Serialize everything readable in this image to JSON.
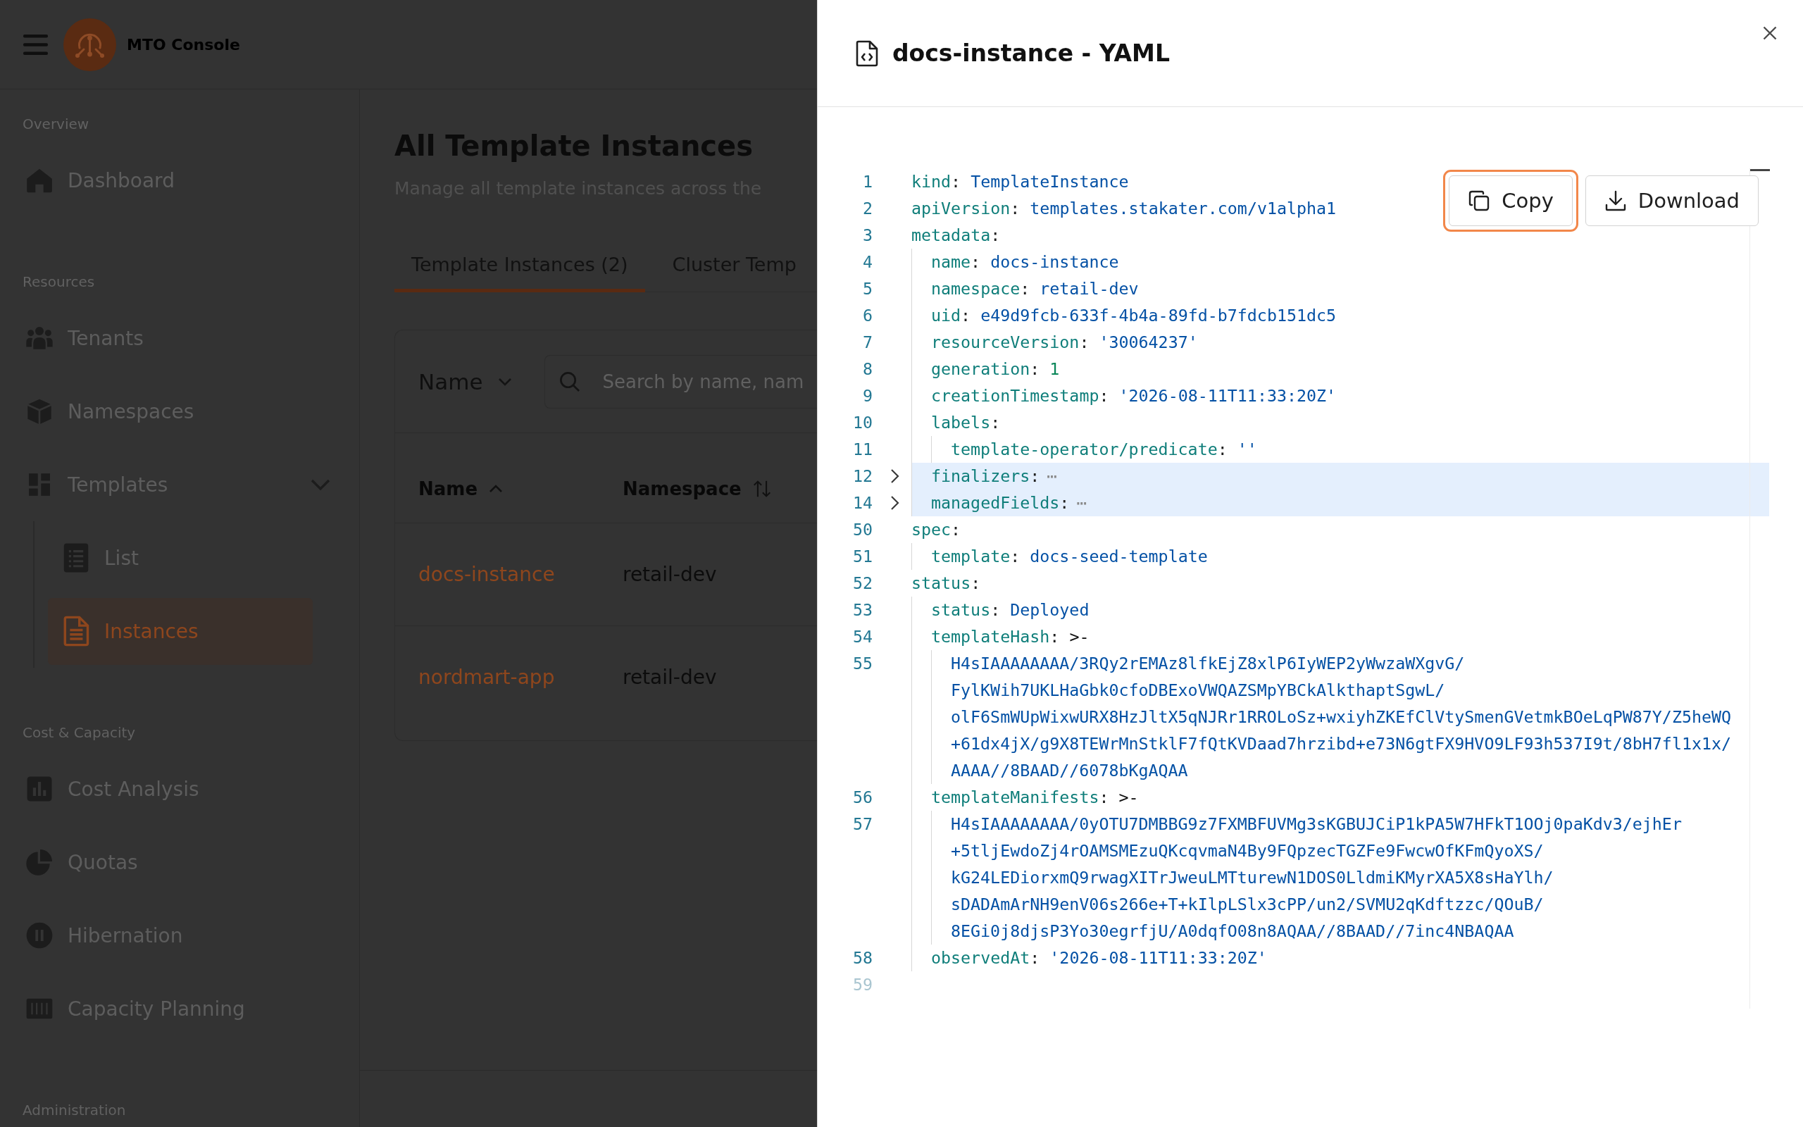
{
  "header": {
    "brand": "MTO Console"
  },
  "sidebar": {
    "sections": [
      {
        "label": "Overview",
        "items": [
          {
            "label": "Dashboard",
            "selected": false
          }
        ]
      },
      {
        "label": "Resources",
        "items": [
          {
            "label": "Tenants",
            "selected": false
          },
          {
            "label": "Namespaces",
            "selected": false
          },
          {
            "label": "Templates",
            "selected": false,
            "expanded": true,
            "children": [
              {
                "label": "List",
                "selected": false
              },
              {
                "label": "Instances",
                "selected": true
              }
            ]
          }
        ]
      },
      {
        "label": "Cost & Capacity",
        "items": [
          {
            "label": "Cost Analysis",
            "selected": false
          },
          {
            "label": "Quotas",
            "selected": false
          },
          {
            "label": "Hibernation",
            "selected": false
          },
          {
            "label": "Capacity Planning",
            "selected": false
          }
        ]
      },
      {
        "label": "Administration"
      }
    ]
  },
  "page": {
    "title": "All Template Instances",
    "subtitle": "Manage all template instances across the",
    "tabs": [
      {
        "label": "Template Instances (2)",
        "selected": true
      },
      {
        "label": "Cluster Temp",
        "selected": false
      }
    ],
    "filter": {
      "field": "Name",
      "search": {
        "placeholder": "Search by name, nam"
      }
    },
    "table": {
      "columns": [
        {
          "label": "Name",
          "sorted": true,
          "kind": "link"
        },
        {
          "label": "Namespace",
          "sorted": false,
          "kind": "text"
        }
      ],
      "rows": [
        {
          "cells": [
            "docs-instance",
            "retail-dev"
          ]
        },
        {
          "cells": [
            "nordmart-app",
            "retail-dev"
          ]
        }
      ]
    }
  },
  "drawer": {
    "title": "docs-instance - YAML",
    "actions": [
      {
        "label": "Copy",
        "focused": true
      },
      {
        "label": "Download",
        "focused": false
      }
    ],
    "editor": {
      "lines": [
        {
          "number": "1",
          "folded": false,
          "dimmed": false,
          "tokens": [
            {
              "text": "kind",
              "kind": "key"
            },
            {
              "text": ": ",
              "kind": "punct"
            },
            {
              "text": "TemplateInstance",
              "kind": "string"
            }
          ]
        },
        {
          "number": "2",
          "folded": false,
          "dimmed": false,
          "tokens": [
            {
              "text": "apiVersion",
              "kind": "key"
            },
            {
              "text": ": ",
              "kind": "punct"
            },
            {
              "text": "templates.stakater.com/v1alpha1",
              "kind": "string"
            }
          ]
        },
        {
          "number": "3",
          "folded": false,
          "dimmed": false,
          "tokens": [
            {
              "text": "metadata",
              "kind": "key"
            },
            {
              "text": ":",
              "kind": "punct"
            }
          ],
          "children": [
            {
              "number": "4",
              "folded": false,
              "dimmed": false,
              "tokens": [
                {
                  "text": "name",
                  "kind": "key"
                },
                {
                  "text": ": ",
                  "kind": "punct"
                },
                {
                  "text": "docs-instance",
                  "kind": "string"
                }
              ]
            },
            {
              "number": "5",
              "folded": false,
              "dimmed": false,
              "tokens": [
                {
                  "text": "namespace",
                  "kind": "key"
                },
                {
                  "text": ": ",
                  "kind": "punct"
                },
                {
                  "text": "retail-dev",
                  "kind": "string"
                }
              ]
            },
            {
              "number": "6",
              "folded": false,
              "dimmed": false,
              "tokens": [
                {
                  "text": "uid",
                  "kind": "key"
                },
                {
                  "text": ": ",
                  "kind": "punct"
                },
                {
                  "text": "e49d9fcb-633f-4b4a-89fd-b7fdcb151dc5",
                  "kind": "string"
                }
              ]
            },
            {
              "number": "7",
              "folded": false,
              "dimmed": false,
              "tokens": [
                {
                  "text": "resourceVersion",
                  "kind": "key"
                },
                {
                  "text": ": ",
                  "kind": "punct"
                },
                {
                  "text": "'30064237'",
                  "kind": "string"
                }
              ]
            },
            {
              "number": "8",
              "folded": false,
              "dimmed": false,
              "tokens": [
                {
                  "text": "generation",
                  "kind": "key"
                },
                {
                  "text": ": ",
                  "kind": "punct"
                },
                {
                  "text": "1",
                  "kind": "number"
                }
              ]
            },
            {
              "number": "9",
              "folded": false,
              "dimmed": false,
              "tokens": [
                {
                  "text": "creationTimestamp",
                  "kind": "key"
                },
                {
                  "text": ": ",
                  "kind": "punct"
                },
                {
                  "text": "'2026-08-11T11:33:20Z'",
                  "kind": "string"
                }
              ]
            },
            {
              "number": "10",
              "folded": false,
              "dimmed": false,
              "tokens": [
                {
                  "text": "labels",
                  "kind": "key"
                },
                {
                  "text": ":",
                  "kind": "punct"
                }
              ],
              "children": [
                {
                  "number": "11",
                  "folded": false,
                  "dimmed": false,
                  "tokens": [
                    {
                      "text": "template-operator/predicate",
                      "kind": "key"
                    },
                    {
                      "text": ": ",
                      "kind": "punct"
                    },
                    {
                      "text": "''",
                      "kind": "string"
                    }
                  ]
                }
              ]
            },
            {
              "number": "12",
              "folded": true,
              "dimmed": false,
              "tokens": [
                {
                  "text": "finalizers",
                  "kind": "key"
                },
                {
                  "text": ":",
                  "kind": "punct"
                }
              ],
              "fold_marker": "⋯"
            },
            {
              "number": "14",
              "folded": true,
              "dimmed": false,
              "tokens": [
                {
                  "text": "managedFields",
                  "kind": "key"
                },
                {
                  "text": ":",
                  "kind": "punct"
                }
              ],
              "fold_marker": "⋯"
            }
          ]
        },
        {
          "number": "50",
          "folded": false,
          "dimmed": false,
          "tokens": [
            {
              "text": "spec",
              "kind": "key"
            },
            {
              "text": ":",
              "kind": "punct"
            }
          ],
          "children": [
            {
              "number": "51",
              "folded": false,
              "dimmed": false,
              "tokens": [
                {
                  "text": "template",
                  "kind": "key"
                },
                {
                  "text": ": ",
                  "kind": "punct"
                },
                {
                  "text": "docs-seed-template",
                  "kind": "string"
                }
              ]
            }
          ]
        },
        {
          "number": "52",
          "folded": false,
          "dimmed": false,
          "tokens": [
            {
              "text": "status",
              "kind": "key"
            },
            {
              "text": ":",
              "kind": "punct"
            }
          ],
          "children": [
            {
              "number": "53",
              "folded": false,
              "dimmed": false,
              "tokens": [
                {
                  "text": "status",
                  "kind": "key"
                },
                {
                  "text": ": ",
                  "kind": "punct"
                },
                {
                  "text": "Deployed",
                  "kind": "string"
                }
              ]
            },
            {
              "number": "54",
              "folded": false,
              "dimmed": false,
              "tokens": [
                {
                  "text": "templateHash",
                  "kind": "key"
                },
                {
                  "text": ": ",
                  "kind": "punct"
                },
                {
                  "text": ">-",
                  "kind": "operator"
                }
              ],
              "children": [
                {
                  "number": "55",
                  "folded": false,
                  "dimmed": false,
                  "tokens": [
                    {
                      "text": "H4sIAAAAAAAA/3RQy2rEMAz8lfkEjZ8xlP6IyWEP2yWwzaWXgvG/",
                      "kind": "string"
                    }
                  ],
                  "wrap": [
                    "FylKWih7UKLHaGbk0cfoDBExoVWQAZSMpYBCkAlkthaptSgwL/",
                    "olF6SmWUpWixwURX8HzJltX5qNJRr1RROLoSz+wxiyhZKEfClVtySmenGVetmkBOeLqPW87Y/Z5heWQ",
                    "+61dx4jX/g9X8TEWrMnStklF7fQtKVDaad7hrzibd+e73N6gtFX9HVO9LF93h537I9t/8bH7fl1x1x/",
                    "AAAA//8BAAD//6078bKgAQAA"
                  ]
                }
              ]
            },
            {
              "number": "56",
              "folded": false,
              "dimmed": false,
              "tokens": [
                {
                  "text": "templateManifests",
                  "kind": "key"
                },
                {
                  "text": ": ",
                  "kind": "punct"
                },
                {
                  "text": ">-",
                  "kind": "operator"
                }
              ],
              "children": [
                {
                  "number": "57",
                  "folded": false,
                  "dimmed": false,
                  "tokens": [
                    {
                      "text": "H4sIAAAAAAAA/0yOTU7DMBBG9z7FXMBFUVMg3sKGBUJCiP1kPA5W7HFkT1OOj0paKdv3/ejhEr",
                      "kind": "string"
                    }
                  ],
                  "wrap": [
                    "+5tljEwdoZj4rOAMSMEzuQKcqvmaN4By9FQpzecTGZFe9FwcwOfKFmQyoXS/",
                    "kG24LEDiorxmQ9rwagXITrJweuLMTturewN1DOS0LldmiKMyrXA5X8sHaYlh/",
                    "sDADAmArNH9enV06s266e+T+kIlpLSlx3cPP/un2/SVMU2qKdftzzc/QOuB/",
                    "8EGi0j8djsP3Yo30egrfjU/A0dqfO08n8AQAA//8BAAD//7inc4NBAQAA"
                  ]
                }
              ]
            },
            {
              "number": "58",
              "folded": false,
              "dimmed": false,
              "tokens": [
                {
                  "text": "observedAt",
                  "kind": "key"
                },
                {
                  "text": ": ",
                  "kind": "punct"
                },
                {
                  "text": "'2026-08-11T11:33:20Z'",
                  "kind": "string"
                }
              ]
            }
          ]
        },
        {
          "number": "59",
          "folded": false,
          "dimmed": true
        }
      ]
    }
  }
}
